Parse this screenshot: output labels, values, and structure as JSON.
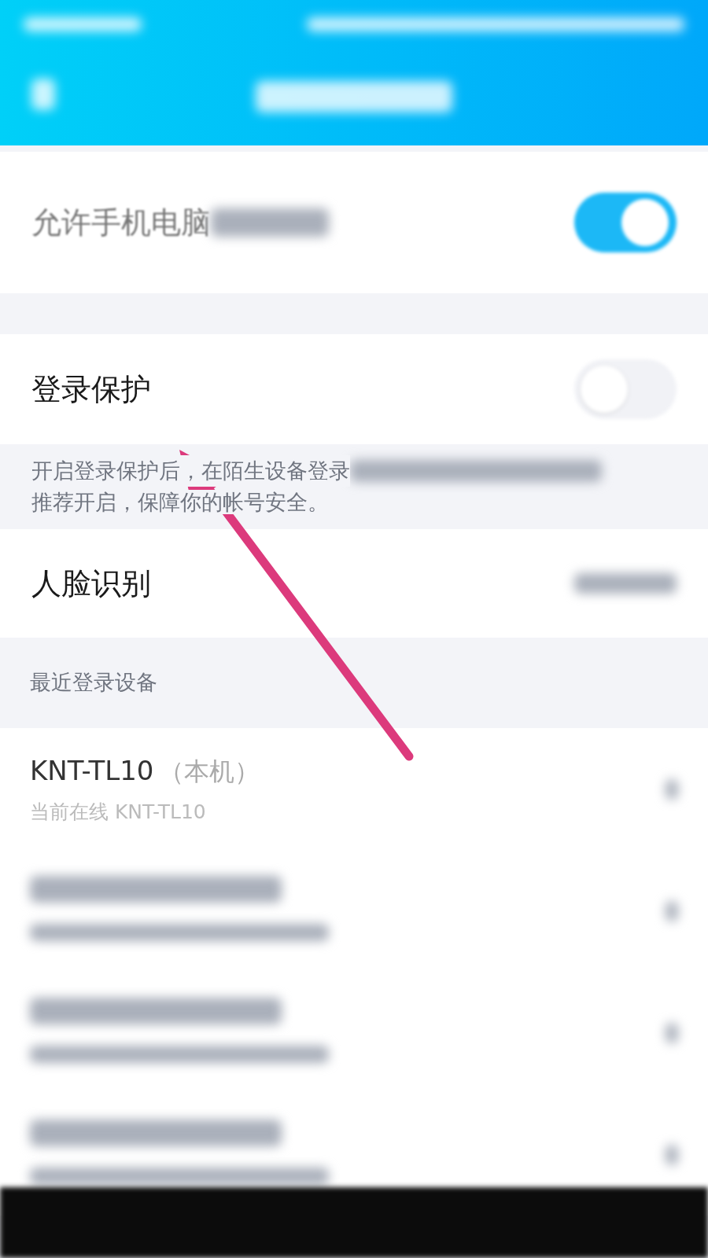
{
  "toggles": [
    {
      "label": "允许手机电脑",
      "on": true,
      "blurred_tail": true
    },
    {
      "label": "登录保护",
      "on": false,
      "blurred_tail": false
    }
  ],
  "description": {
    "line_1": "开启登录保护后，在陌生设备登录",
    "line_2": "推荐开启，保障你的帐号安全。"
  },
  "face_row": {
    "label": "人脸识别"
  },
  "section_header": "最近登录设备",
  "devices": [
    {
      "kind": "device",
      "name": "KNT-TL10",
      "tag": "（本机）",
      "status": "当前在线 KNT-TL10"
    },
    {
      "kind": "blurred"
    },
    {
      "kind": "blurred"
    },
    {
      "kind": "blurred"
    }
  ]
}
